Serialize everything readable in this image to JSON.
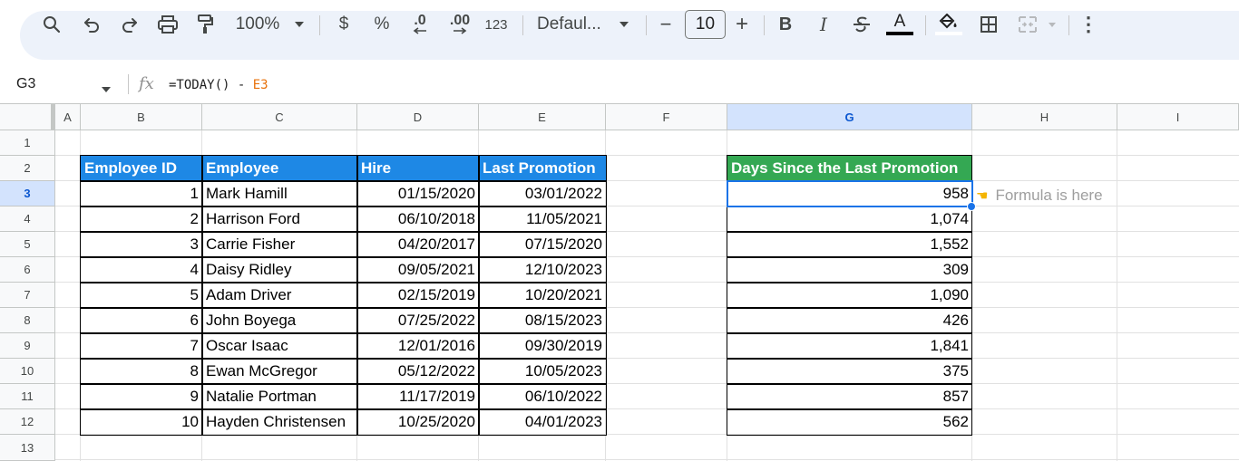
{
  "toolbar": {
    "zoom": "100%",
    "currency": "$",
    "percent": "%",
    "dec_decrease": ".0",
    "dec_increase": ".00",
    "number_format": "123",
    "font": "Defaul...",
    "font_size": "10",
    "minus": "−",
    "plus": "+",
    "bold": "B",
    "italic": "I",
    "text_color_glyph": "A",
    "more": "⋮"
  },
  "formula_bar": {
    "name_box": "G3",
    "fx": "fx",
    "formula_prefix": "=TODAY() - ",
    "formula_ref": "E3"
  },
  "columns": [
    "A",
    "B",
    "C",
    "D",
    "E",
    "F",
    "G",
    "H",
    "I"
  ],
  "rows": [
    "1",
    "2",
    "3",
    "4",
    "5",
    "6",
    "7",
    "8",
    "9",
    "10",
    "11",
    "12",
    "13"
  ],
  "table": {
    "headers": [
      "Employee ID",
      "Employee",
      "Hire",
      "Last Promotion"
    ],
    "rows": [
      [
        "1",
        "Mark Hamill",
        "01/15/2020",
        "03/01/2022"
      ],
      [
        "2",
        "Harrison Ford",
        "06/10/2018",
        "11/05/2021"
      ],
      [
        "3",
        "Carrie Fisher",
        "04/20/2017",
        "07/15/2020"
      ],
      [
        "4",
        "Daisy Ridley",
        "09/05/2021",
        "12/10/2023"
      ],
      [
        "5",
        "Adam Driver",
        "02/15/2019",
        "10/20/2021"
      ],
      [
        "6",
        "John Boyega",
        "07/25/2022",
        "08/15/2023"
      ],
      [
        "7",
        "Oscar Isaac",
        "12/01/2016",
        "09/30/2019"
      ],
      [
        "8",
        "Ewan McGregor",
        "05/12/2022",
        "10/05/2023"
      ],
      [
        "9",
        "Natalie Portman",
        "11/17/2019",
        "06/10/2022"
      ],
      [
        "10",
        "Hayden Christensen",
        "10/25/2020",
        "04/01/2023"
      ]
    ]
  },
  "days_table": {
    "header": "Days Since the Last Promotion",
    "values": [
      "958",
      "1,074",
      "1,552",
      "309",
      "1,090",
      "426",
      "1,841",
      "375",
      "857",
      "562"
    ]
  },
  "note": "Formula is here",
  "colors": {
    "header_blue": "#1e88e5",
    "header_green": "#34a853",
    "selection": "#1a73e8",
    "formula_ref": "#e8710a"
  }
}
